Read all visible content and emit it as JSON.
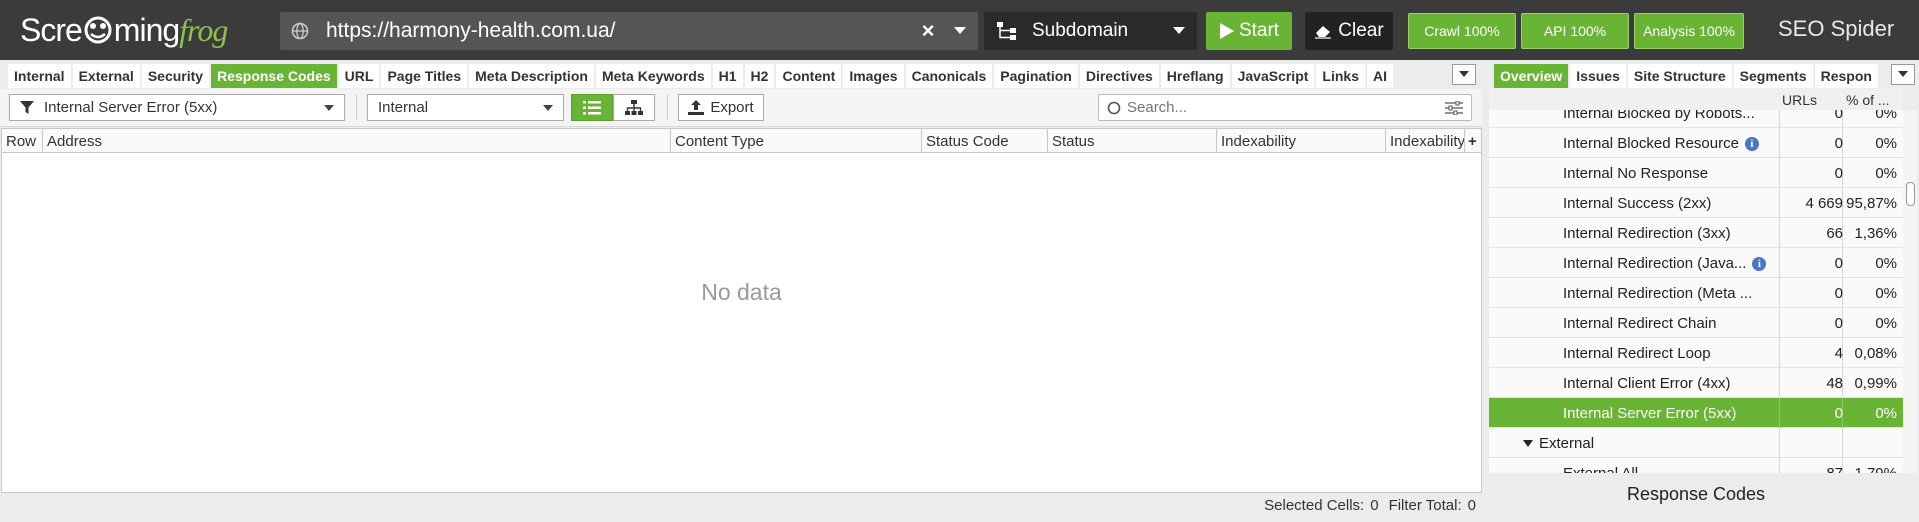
{
  "header": {
    "logo_part1": "Scre",
    "logo_part2": "ming",
    "logo_part3": "frog",
    "url": "https://harmony-health.com.ua/",
    "mode": "Subdomain",
    "start_label": "Start",
    "clear_label": "Clear",
    "progress": [
      {
        "label": "Crawl 100%",
        "value": 100
      },
      {
        "label": "API 100%",
        "value": 100
      },
      {
        "label": "Analysis 100%",
        "value": 100
      }
    ],
    "brand_seo": "SEO",
    "brand_spider": "Spider",
    "accent_color": "#6ab435"
  },
  "left_tabs": [
    "Internal",
    "External",
    "Security",
    "Response Codes",
    "URL",
    "Page Titles",
    "Meta Description",
    "Meta Keywords",
    "H1",
    "H2",
    "Content",
    "Images",
    "Canonicals",
    "Pagination",
    "Directives",
    "Hreflang",
    "JavaScript",
    "Links",
    "AI"
  ],
  "left_active_tab": "Response Codes",
  "filter": {
    "type_filter": "Internal Server Error (5xx)",
    "scope_filter": "Internal",
    "export_label": "Export",
    "search_placeholder": "Search..."
  },
  "grid": {
    "columns": [
      "Row",
      "Address",
      "Content Type",
      "Status Code",
      "Status",
      "Indexability",
      "Indexability"
    ],
    "empty_message": "No data",
    "selected_cells_label": "Selected Cells:",
    "selected_cells": "0",
    "filter_total_label": "Filter Total:",
    "filter_total": "0"
  },
  "right_tabs": [
    "Overview",
    "Issues",
    "Site Structure",
    "Segments",
    "Respon"
  ],
  "right_active_tab": "Overview",
  "overview": {
    "col_urls": "URLs",
    "col_pct": "% of ...",
    "rows": [
      {
        "label": "Internal Blocked by Robots...",
        "urls": "0",
        "pct": "0%",
        "info": false
      },
      {
        "label": "Internal Blocked Resource",
        "urls": "0",
        "pct": "0%",
        "info": true
      },
      {
        "label": "Internal No Response",
        "urls": "0",
        "pct": "0%",
        "info": false
      },
      {
        "label": "Internal Success (2xx)",
        "urls": "4 669",
        "pct": "95,87%",
        "info": false
      },
      {
        "label": "Internal Redirection (3xx)",
        "urls": "66",
        "pct": "1,36%",
        "info": false
      },
      {
        "label": "Internal Redirection (Java...",
        "urls": "0",
        "pct": "0%",
        "info": true
      },
      {
        "label": "Internal Redirection (Meta ...",
        "urls": "0",
        "pct": "0%",
        "info": false
      },
      {
        "label": "Internal Redirect Chain",
        "urls": "0",
        "pct": "0%",
        "info": false
      },
      {
        "label": "Internal Redirect Loop",
        "urls": "4",
        "pct": "0,08%",
        "info": false
      },
      {
        "label": "Internal Client Error (4xx)",
        "urls": "48",
        "pct": "0,99%",
        "info": false
      },
      {
        "label": "Internal Server Error (5xx)",
        "urls": "0",
        "pct": "0%",
        "info": false,
        "selected": true
      },
      {
        "label": "External",
        "urls": "",
        "pct": "",
        "group": true
      },
      {
        "label": "External All",
        "urls": "87",
        "pct": "1,79%",
        "info": false
      }
    ],
    "panel_title": "Response Codes"
  }
}
